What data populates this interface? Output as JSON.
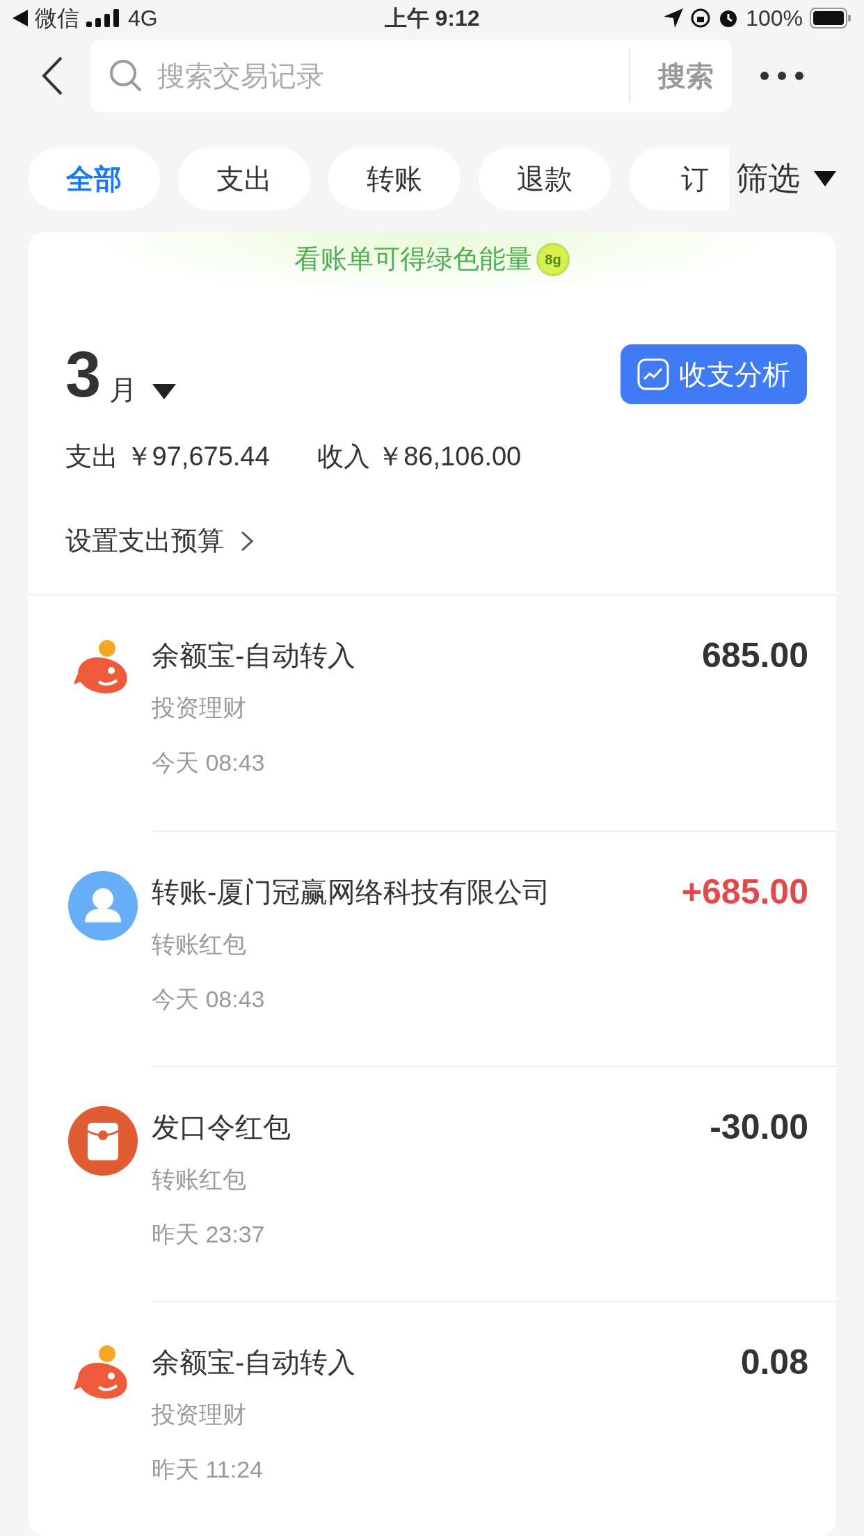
{
  "status_bar": {
    "back_app": "微信",
    "network": "4G",
    "time": "上午 9:12",
    "battery": "100%"
  },
  "search": {
    "placeholder": "搜索交易记录",
    "button": "搜索"
  },
  "tabs": [
    {
      "label": "全部",
      "selected": true
    },
    {
      "label": "支出",
      "selected": false
    },
    {
      "label": "转账",
      "selected": false
    },
    {
      "label": "退款",
      "selected": false
    },
    {
      "label": "订",
      "selected": false
    }
  ],
  "filter": "筛选",
  "banner": {
    "text": "看账单可得绿色能量",
    "badge": "8g"
  },
  "summary": {
    "month_number": "3",
    "month_unit": "月",
    "analysis_button": "收支分析",
    "expense": "支出 ￥97,675.44",
    "income": "收入 ￥86,106.00",
    "budget_link": "设置支出预算"
  },
  "transactions": [
    {
      "kind": "fund",
      "title": "余额宝-自动转入",
      "category": "投资理财",
      "time": "今天 08:43",
      "amount": "685.00",
      "income": false
    },
    {
      "kind": "person",
      "title": "转账-厦门冠赢网络科技有限公司",
      "category": "转账红包",
      "time": "今天 08:43",
      "amount": "+685.00",
      "income": true
    },
    {
      "kind": "packet",
      "title": "发口令红包",
      "category": "转账红包",
      "time": "昨天 23:37",
      "amount": "-30.00",
      "income": false
    },
    {
      "kind": "fund",
      "title": "余额宝-自动转入",
      "category": "投资理财",
      "time": "昨天 11:24",
      "amount": "0.08",
      "income": false
    }
  ]
}
